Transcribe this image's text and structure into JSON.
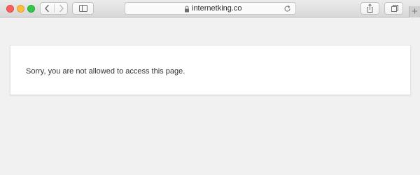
{
  "browser": {
    "url": "internetking.co",
    "icons": {
      "back": "chevron-left-icon",
      "forward": "chevron-right-icon",
      "sidebar": "sidebar-icon",
      "lock": "lock-icon",
      "reload": "reload-icon",
      "share": "share-icon",
      "tabs": "tabs-icon",
      "new_tab": "plus-icon"
    },
    "new_tab_label": "+"
  },
  "page": {
    "message": "Sorry, you are not allowed to access this page."
  },
  "colors": {
    "close": "#fc605c",
    "minimize": "#fdbc40",
    "maximize": "#34c84a",
    "page_background": "#f1f1f1",
    "card_background": "#ffffff"
  }
}
